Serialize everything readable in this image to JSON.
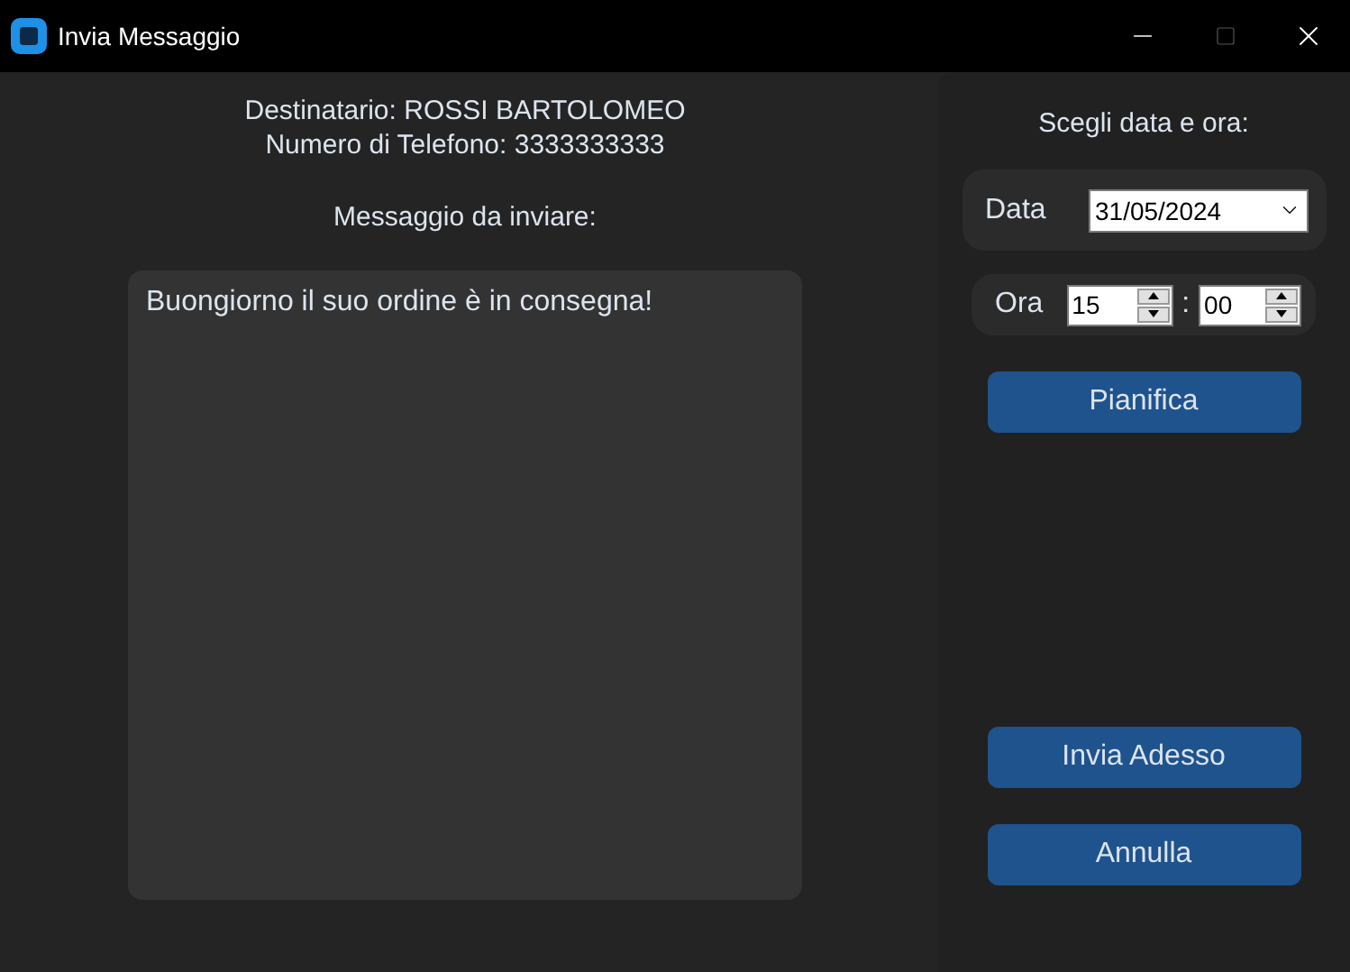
{
  "window": {
    "title": "Invia Messaggio"
  },
  "recipient": {
    "name_line": "Destinatario: ROSSI BARTOLOMEO",
    "phone_line": "Numero di Telefono: 3333333333"
  },
  "message": {
    "label": "Messaggio da inviare:",
    "value": "Buongiorno il suo ordine è in consegna!"
  },
  "schedule": {
    "heading": "Scegli data e ora:",
    "date_label": "Data",
    "date_value": "31/05/2024",
    "time_label": "Ora",
    "hour": "15",
    "separator": ":",
    "minute": "00"
  },
  "schedule_button": {
    "label": "Pianifica"
  },
  "action_buttons": [
    {
      "label": "Invia Adesso"
    },
    {
      "label": "Annulla"
    }
  ]
}
